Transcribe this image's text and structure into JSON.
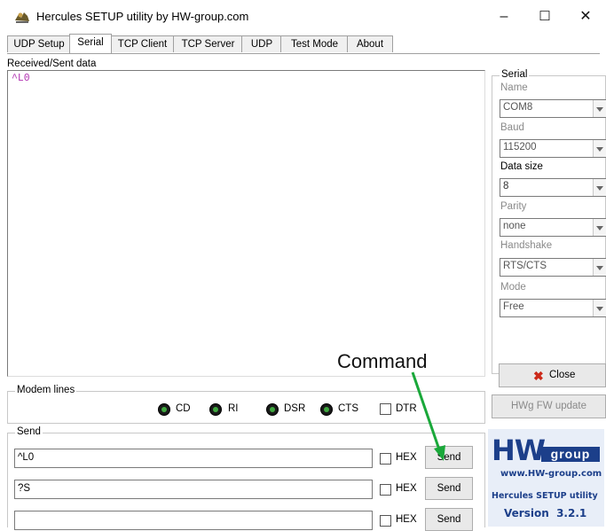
{
  "window": {
    "title": "Hercules SETUP utility by HW-group.com",
    "minimize": "–",
    "maximize": "☐",
    "close": "✕"
  },
  "tabs": [
    {
      "label": "UDP Setup"
    },
    {
      "label": "Serial"
    },
    {
      "label": "TCP Client"
    },
    {
      "label": "TCP Server"
    },
    {
      "label": "UDP"
    },
    {
      "label": "Test Mode"
    },
    {
      "label": "About"
    }
  ],
  "received": {
    "label": "Received/Sent data",
    "content": "^L0"
  },
  "serial": {
    "group_label": "Serial",
    "name_label": "Name",
    "name_value": "COM8",
    "baud_label": "Baud",
    "baud_value": "115200",
    "datasize_label": "Data size",
    "datasize_value": "8",
    "parity_label": "Parity",
    "parity_value": "none",
    "handshake_label": "Handshake",
    "handshake_value": "RTS/CTS",
    "mode_label": "Mode",
    "mode_value": "Free",
    "close_label": "Close",
    "hwg_update_label": "HWg FW update"
  },
  "modem": {
    "group_label": "Modem lines",
    "cd": "CD",
    "ri": "RI",
    "dsr": "DSR",
    "cts": "CTS",
    "dtr": "DTR"
  },
  "annotation": {
    "text": "Command",
    "color": "#1aa83a"
  },
  "send": {
    "group_label": "Send",
    "rows": [
      {
        "value": "^L0",
        "hex_label": "HEX",
        "send_label": "Send"
      },
      {
        "value": "?S",
        "hex_label": "HEX",
        "send_label": "Send"
      },
      {
        "value": "",
        "hex_label": "HEX",
        "send_label": "Send"
      }
    ]
  },
  "logo": {
    "brand": "HW",
    "group": "group",
    "url": "www.HW-group.com",
    "product": "Hercules SETUP utility",
    "version": "Version  3.2.1"
  }
}
